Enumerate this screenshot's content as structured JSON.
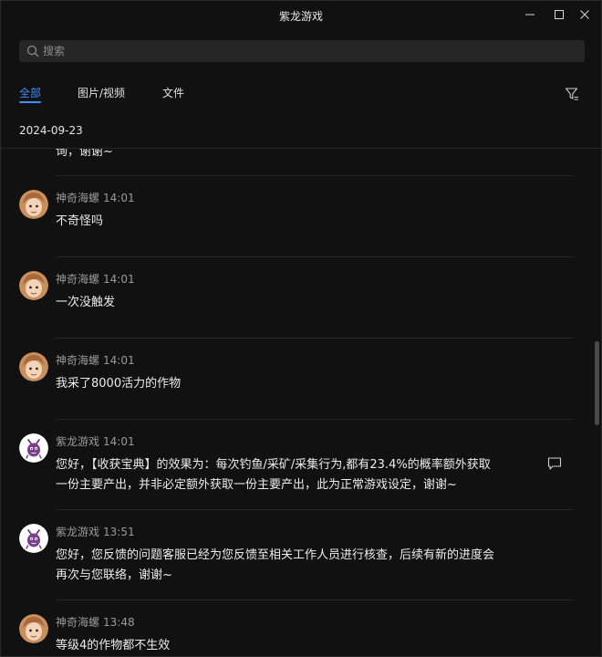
{
  "window": {
    "title": "紫龙游戏"
  },
  "search": {
    "placeholder": "搜索"
  },
  "tabs": [
    {
      "label": "全部"
    },
    {
      "label": "图片/视频"
    },
    {
      "label": "文件"
    }
  ],
  "date": "2024-09-23",
  "list": {
    "truncated_text": "询，谢谢~",
    "messages": [
      {
        "sender": "神奇海螺",
        "time": "14:01",
        "text": "不奇怪吗",
        "avatar": "user-avatar"
      },
      {
        "sender": "神奇海螺",
        "time": "14:01",
        "text": "一次没触发",
        "avatar": "user-avatar"
      },
      {
        "sender": "神奇海螺",
        "time": "14:01",
        "text": "我采了8000活力的作物",
        "avatar": "user-avatar"
      },
      {
        "sender": "紫龙游戏",
        "time": "14:01",
        "text_lines": [
          "您好，【收获宝典】的效果为：每次钓鱼/采矿/采集行为,都有23.4%的概率额外获取",
          "一份主要产出，并非必定额外获取一份主要产出，此为正常游戏设定，谢谢~"
        ],
        "avatar": "official-avatar"
      },
      {
        "sender": "紫龙游戏",
        "time": "13:51",
        "text_lines": [
          "您好，您反馈的问题客服已经为您反馈至相关工作人员进行核查，后续有新的进度会",
          "再次与您联络，谢谢~"
        ],
        "avatar": "official-avatar"
      },
      {
        "sender": "神奇海螺",
        "time": "13:48",
        "text": "等级4的作物都不生效",
        "avatar": "user-avatar"
      }
    ]
  },
  "colors": {
    "accent": "#3e8ef7",
    "background": "#111111"
  }
}
